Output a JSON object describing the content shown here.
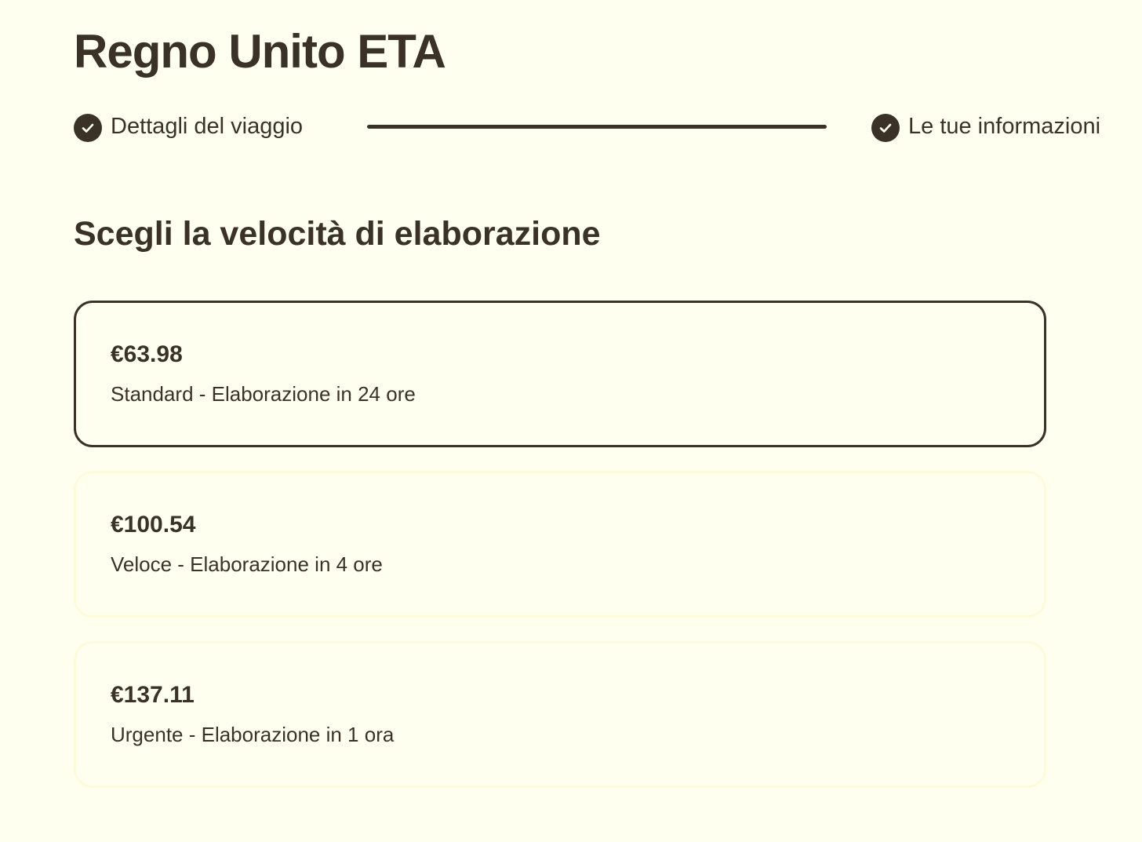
{
  "page": {
    "title": "Regno Unito ETA"
  },
  "stepper": {
    "steps": [
      {
        "label": "Dettagli del viaggio",
        "icon": "check-circle-icon",
        "completed": true
      },
      {
        "label": "Le tue informazioni",
        "icon": "check-circle-icon",
        "completed": true
      }
    ]
  },
  "processing": {
    "heading": "Scegli la velocità di elaborazione",
    "options": [
      {
        "price": "€63.98",
        "description": "Standard - Elaborazione in 24 ore",
        "selected": true
      },
      {
        "price": "€100.54",
        "description": "Veloce - Elaborazione in 4 ore",
        "selected": false
      },
      {
        "price": "€137.11",
        "description": "Urgente - Elaborazione in 1 ora",
        "selected": false
      }
    ]
  },
  "colors": {
    "background": "#FFFFF0",
    "text": "#3A3226",
    "selected_border": "#3A3226",
    "unselected_border": "#FCFCDB"
  }
}
